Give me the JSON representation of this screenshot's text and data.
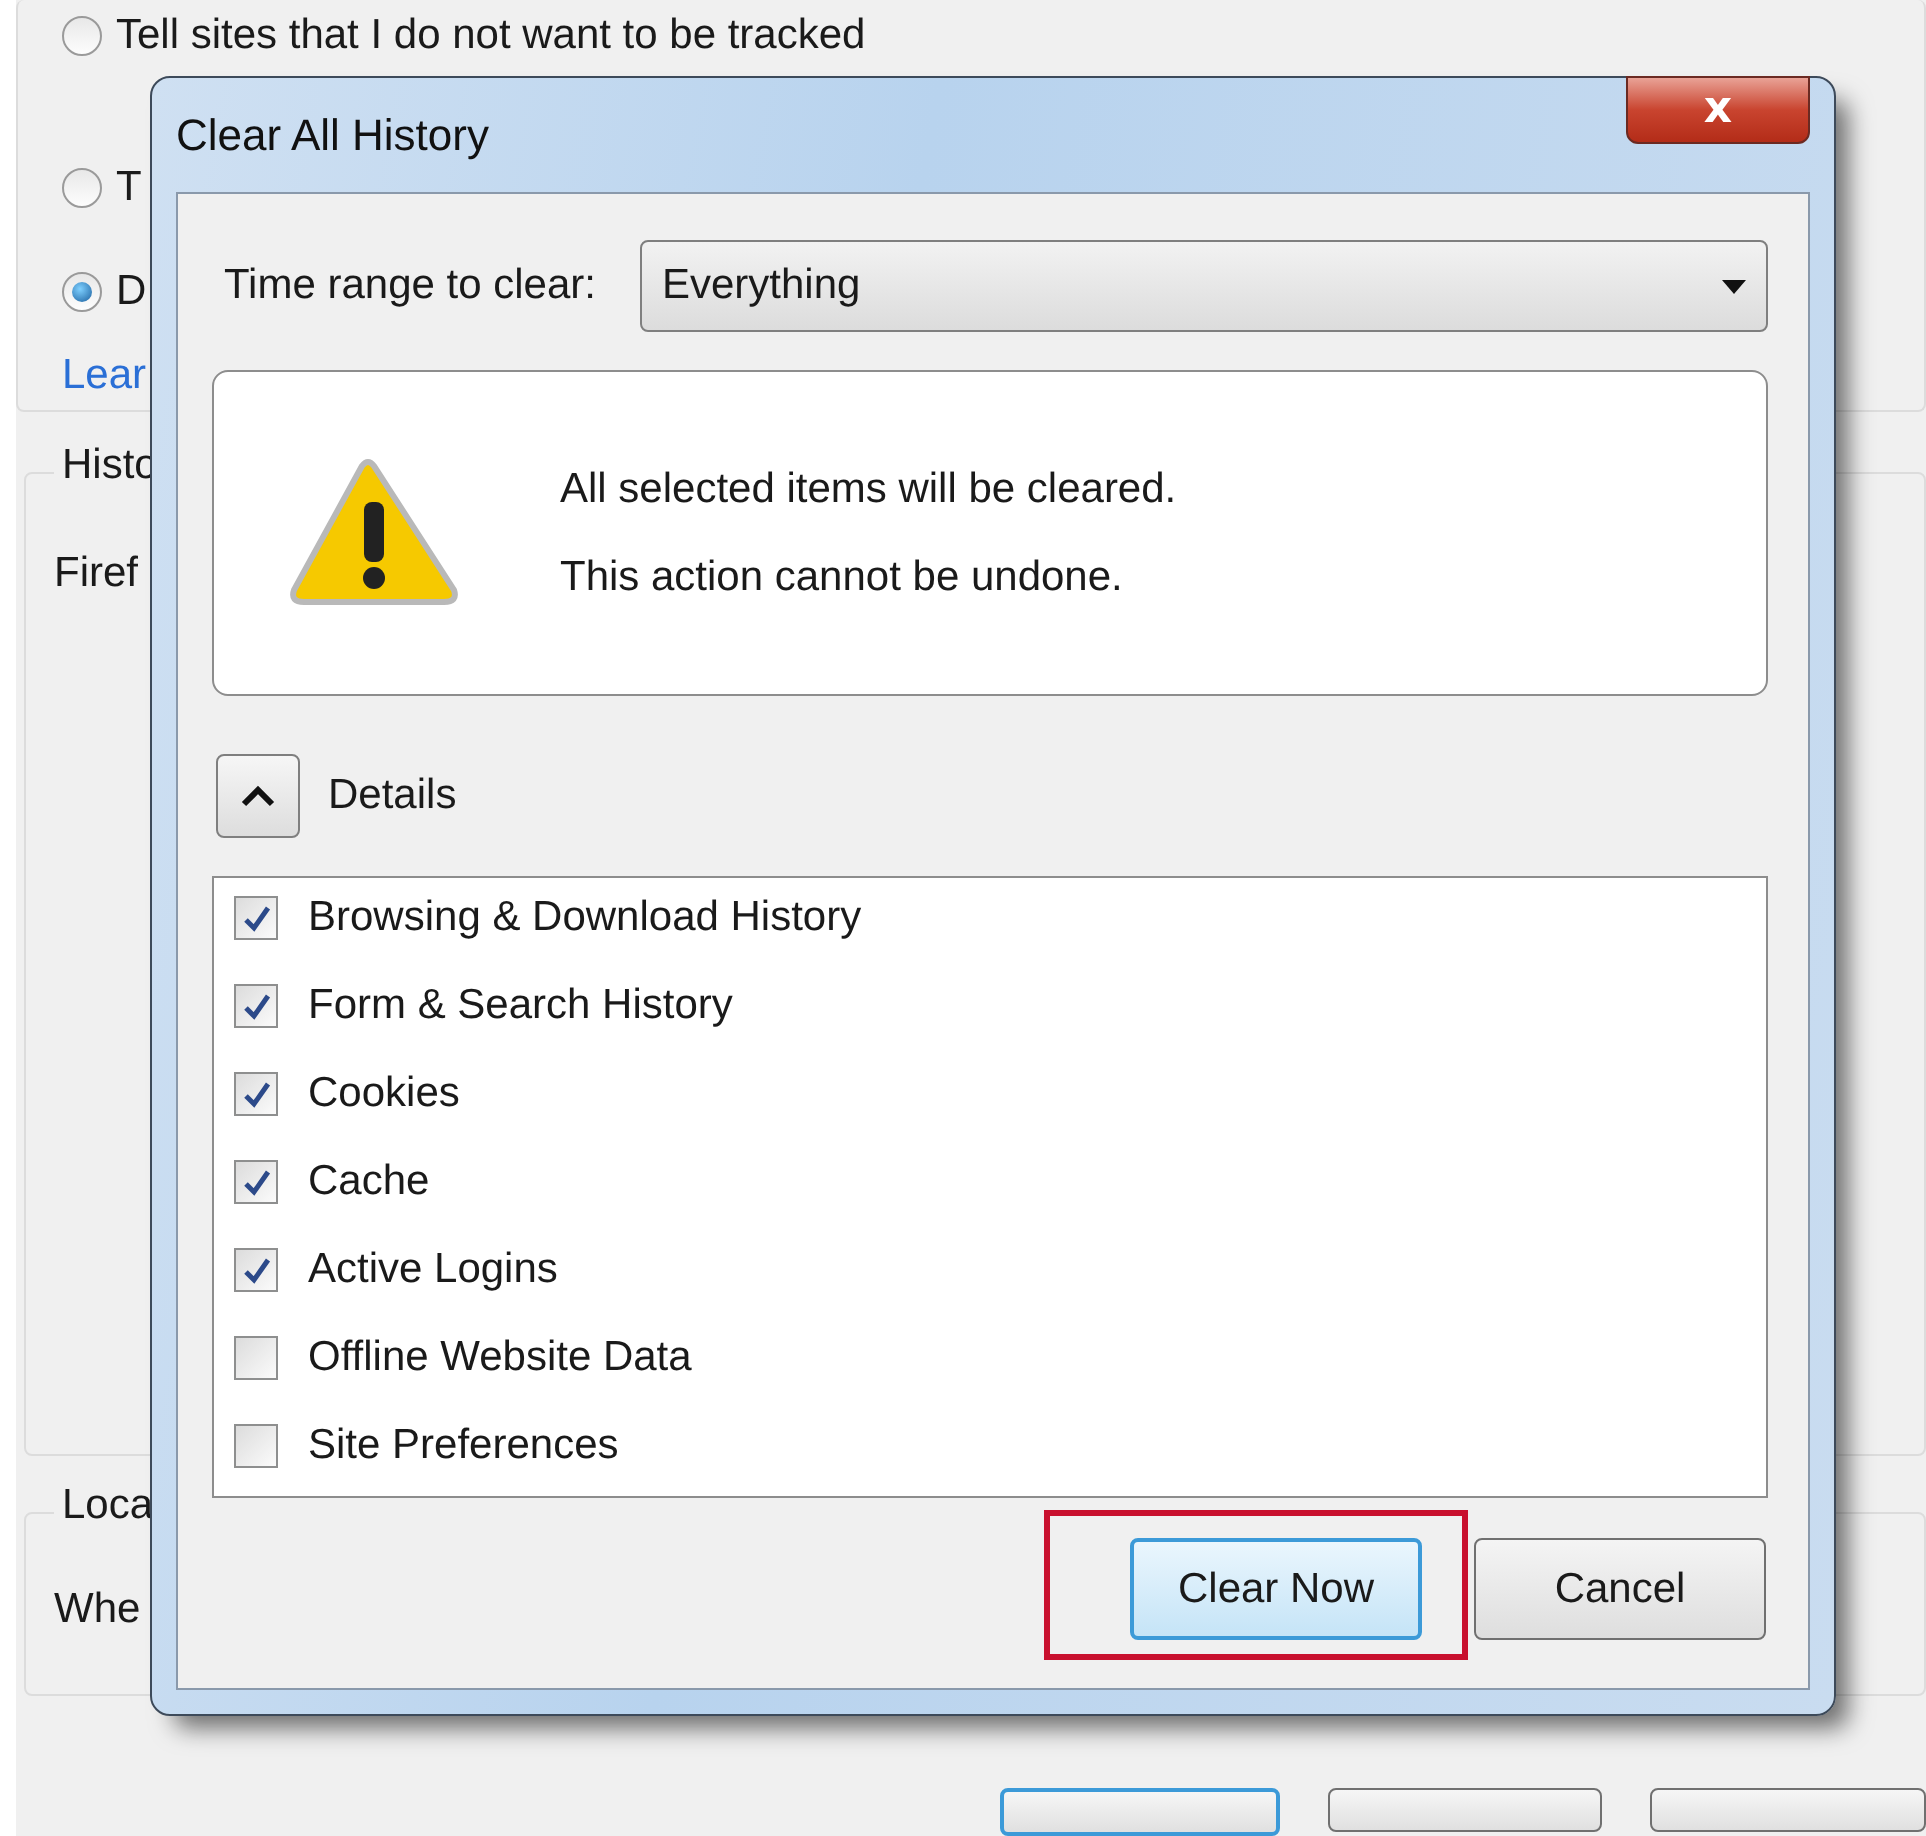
{
  "background": {
    "tracking": {
      "radios": [
        {
          "label": "Tell sites that I do not want to be tracked",
          "selected": false
        },
        {
          "label": "T",
          "selected": false
        },
        {
          "label": "D",
          "selected": true
        }
      ],
      "link": "Lear"
    },
    "groups": [
      {
        "legend": "Histo",
        "text": "Firef"
      },
      {
        "legend": "Loca",
        "text": "Whe"
      }
    ],
    "footer_buttons": [
      {
        "default": true
      },
      {
        "default": false
      },
      {
        "default": false
      }
    ]
  },
  "dialog": {
    "title": "Clear All History",
    "close": "x",
    "time_range": {
      "label": "Time range to clear:",
      "value": "Everything"
    },
    "warning": {
      "lines": [
        "All selected items will be cleared.",
        "This action cannot be undone."
      ]
    },
    "details": {
      "label": "Details",
      "expanded": true
    },
    "items": [
      {
        "label": "Browsing & Download History",
        "checked": true
      },
      {
        "label": "Form & Search History",
        "checked": true
      },
      {
        "label": "Cookies",
        "checked": true
      },
      {
        "label": "Cache",
        "checked": true
      },
      {
        "label": "Active Logins",
        "checked": true
      },
      {
        "label": "Offline Website Data",
        "checked": false
      },
      {
        "label": "Site Preferences",
        "checked": false
      }
    ],
    "buttons": [
      {
        "label": "Clear Now",
        "default": true,
        "annotated": true
      },
      {
        "label": "Cancel",
        "default": false,
        "annotated": false
      }
    ]
  }
}
